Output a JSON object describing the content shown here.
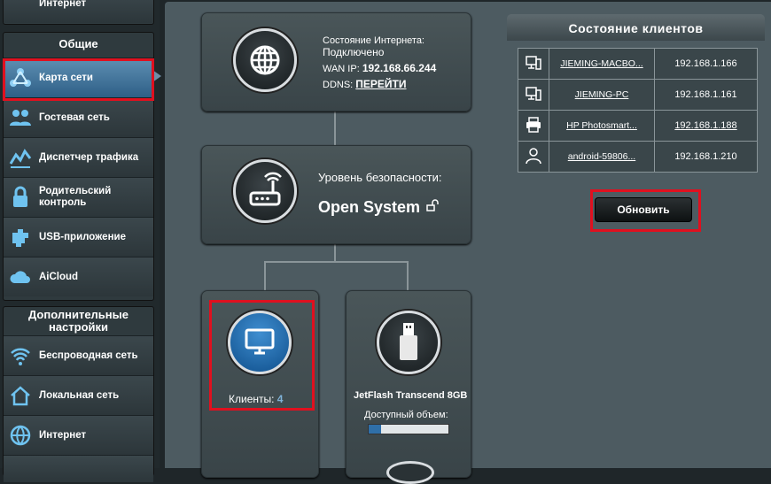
{
  "sidebar": {
    "top_item_label": "Интернет",
    "general_header": "Общие",
    "general_items": [
      {
        "label": "Карта сети",
        "icon": "network-map-icon"
      },
      {
        "label": "Гостевая сеть",
        "icon": "guest-network-icon"
      },
      {
        "label": "Диспетчер трафика",
        "icon": "traffic-manager-icon"
      },
      {
        "label": "Родительский контроль",
        "icon": "parental-control-icon"
      },
      {
        "label": "USB-приложение",
        "icon": "usb-app-icon"
      },
      {
        "label": "AiCloud",
        "icon": "aicloud-icon"
      }
    ],
    "advanced_header": "Дополнительные настройки",
    "advanced_items": [
      {
        "label": "Беспроводная сеть",
        "icon": "wireless-icon"
      },
      {
        "label": "Локальная сеть",
        "icon": "lan-icon"
      },
      {
        "label": "Интернет",
        "icon": "wan-globe-icon"
      }
    ]
  },
  "internet_card": {
    "status_label": "Состояние Интернета:",
    "status_value": "Подключено",
    "wan_ip_label": "WAN IP:",
    "wan_ip": "192.168.66.244",
    "ddns_label": "DDNS:",
    "ddns_link": "ПЕРЕЙТИ"
  },
  "security_card": {
    "label": "Уровень безопасности:",
    "value": "Open System"
  },
  "clients_card": {
    "label": "Клиенты:",
    "count": "4"
  },
  "usb_card": {
    "device_name": "JetFlash Transcend 8GB",
    "capacity_label": "Доступный объем:",
    "capacity_fraction": 0.15
  },
  "clients_panel": {
    "title": "Состояние клиентов",
    "clients": [
      {
        "name": "JIEMING-MACBO...",
        "ip": "192.168.1.166",
        "icon": "pc-icon",
        "ip_link": false
      },
      {
        "name": "JIEMING-PC",
        "ip": "192.168.1.161",
        "icon": "pc-icon",
        "ip_link": false
      },
      {
        "name": "HP Photosmart...",
        "ip": "192.168.1.188",
        "icon": "printer-icon",
        "ip_link": true
      },
      {
        "name": "android-59806...",
        "ip": "192.168.1.210",
        "icon": "person-icon",
        "ip_link": false
      }
    ],
    "refresh_button": "Обновить"
  },
  "colors": {
    "accent_active": "#4a7ca3",
    "highlight_red": "#e0101f",
    "count_blue": "#7fb2d9"
  }
}
